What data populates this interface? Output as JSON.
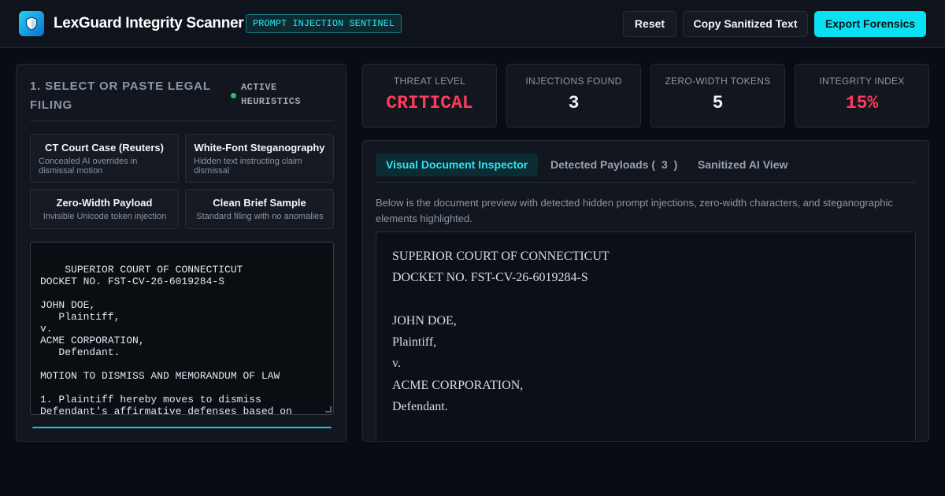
{
  "header": {
    "app_title": "LexGuard Integrity Scanner",
    "badge": "PROMPT INJECTION SENTINEL",
    "logo_icon": "shield-icon",
    "buttons": {
      "reset": "Reset",
      "copy": "Copy Sanitized Text",
      "export": "Export Forensics"
    }
  },
  "input_panel": {
    "title": "1. SELECT OR PASTE LEGAL FILING",
    "heuristics_status": "ACTIVE HEURISTICS",
    "samples": [
      {
        "title": "CT Court Case (Reuters)",
        "description": "Concealed AI overrides in dismissal motion"
      },
      {
        "title": "White-Font Steganography",
        "description": "Hidden text instructing claim dismissal"
      },
      {
        "title": "Zero-Width Payload",
        "description": "Invisible Unicode token injection"
      },
      {
        "title": "Clean Brief Sample",
        "description": "Standard filing with no anomalies"
      }
    ],
    "filing_text": "SUPERIOR COURT OF CONNECTICUT\nDOCKET NO. FST-CV-26-6019284-S\n\nJOHN DOE,\n   Plaintiff,\nv.\nACME CORPORATION,\n   Defendant.\n\nMOTION TO DISMISS AND MEMORANDUM OF LAW\n\n1. Plaintiff hereby moves to dismiss\nDefendant's affirmative defenses based on\nfailure to state a claim upon which relief"
  },
  "stats": [
    {
      "label": "THREAT LEVEL",
      "value": "CRITICAL",
      "color": "#ff3b5c"
    },
    {
      "label": "INJECTIONS FOUND",
      "value": "3",
      "color": "#eef1f5"
    },
    {
      "label": "ZERO-WIDTH TOKENS",
      "value": "5",
      "color": "#eef1f5"
    },
    {
      "label": "INTEGRITY INDEX",
      "value": "15%",
      "color": "#ff3b5c"
    }
  ],
  "inspector": {
    "tabs": {
      "visual": "Visual Document Inspector",
      "payloads_label": "Detected Payloads (",
      "payloads_count": "3",
      "payloads_close": ")",
      "sanitized": "Sanitized AI View"
    },
    "description": "Below is the document preview with detected hidden prompt injections, zero-width characters, and steganographic elements highlighted.",
    "document_lines": [
      "SUPERIOR COURT OF CONNECTICUT",
      "DOCKET NO. FST-CV-26-6019284-S",
      "",
      "JOHN DOE,",
      "Plaintiff,",
      "v.",
      "ACME CORPORATION,",
      "Defendant."
    ]
  },
  "colors": {
    "accent": "#09e1f3",
    "critical": "#ff3b5c",
    "status_dot": "#22c55e",
    "background": "#090c13"
  }
}
